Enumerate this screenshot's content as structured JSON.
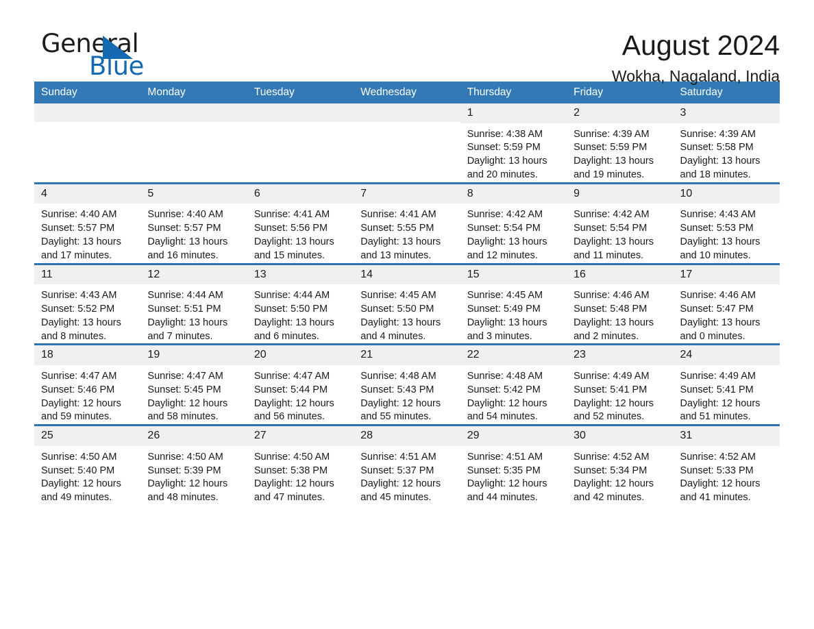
{
  "brand": {
    "name_part1": "General",
    "name_part2": "Blue",
    "triangle_color": "#1569b0",
    "blue_text_color": "#1569b0"
  },
  "header": {
    "title": "August 2024",
    "location": "Wokha, Nagaland, India"
  },
  "theme": {
    "header_blue": "#3279b6",
    "row_divider_blue": "#2e74b0",
    "daynum_band": "#f0f0f0",
    "text": "#1a1a1a"
  },
  "weekday_headers": [
    "Sunday",
    "Monday",
    "Tuesday",
    "Wednesday",
    "Thursday",
    "Friday",
    "Saturday"
  ],
  "weeks": [
    [
      {
        "day": "",
        "sunrise": "",
        "sunset": "",
        "daylight_line1": "",
        "daylight_line2": ""
      },
      {
        "day": "",
        "sunrise": "",
        "sunset": "",
        "daylight_line1": "",
        "daylight_line2": ""
      },
      {
        "day": "",
        "sunrise": "",
        "sunset": "",
        "daylight_line1": "",
        "daylight_line2": ""
      },
      {
        "day": "",
        "sunrise": "",
        "sunset": "",
        "daylight_line1": "",
        "daylight_line2": ""
      },
      {
        "day": "1",
        "sunrise": "Sunrise: 4:38 AM",
        "sunset": "Sunset: 5:59 PM",
        "daylight_line1": "Daylight: 13 hours",
        "daylight_line2": "and 20 minutes."
      },
      {
        "day": "2",
        "sunrise": "Sunrise: 4:39 AM",
        "sunset": "Sunset: 5:59 PM",
        "daylight_line1": "Daylight: 13 hours",
        "daylight_line2": "and 19 minutes."
      },
      {
        "day": "3",
        "sunrise": "Sunrise: 4:39 AM",
        "sunset": "Sunset: 5:58 PM",
        "daylight_line1": "Daylight: 13 hours",
        "daylight_line2": "and 18 minutes."
      }
    ],
    [
      {
        "day": "4",
        "sunrise": "Sunrise: 4:40 AM",
        "sunset": "Sunset: 5:57 PM",
        "daylight_line1": "Daylight: 13 hours",
        "daylight_line2": "and 17 minutes."
      },
      {
        "day": "5",
        "sunrise": "Sunrise: 4:40 AM",
        "sunset": "Sunset: 5:57 PM",
        "daylight_line1": "Daylight: 13 hours",
        "daylight_line2": "and 16 minutes."
      },
      {
        "day": "6",
        "sunrise": "Sunrise: 4:41 AM",
        "sunset": "Sunset: 5:56 PM",
        "daylight_line1": "Daylight: 13 hours",
        "daylight_line2": "and 15 minutes."
      },
      {
        "day": "7",
        "sunrise": "Sunrise: 4:41 AM",
        "sunset": "Sunset: 5:55 PM",
        "daylight_line1": "Daylight: 13 hours",
        "daylight_line2": "and 13 minutes."
      },
      {
        "day": "8",
        "sunrise": "Sunrise: 4:42 AM",
        "sunset": "Sunset: 5:54 PM",
        "daylight_line1": "Daylight: 13 hours",
        "daylight_line2": "and 12 minutes."
      },
      {
        "day": "9",
        "sunrise": "Sunrise: 4:42 AM",
        "sunset": "Sunset: 5:54 PM",
        "daylight_line1": "Daylight: 13 hours",
        "daylight_line2": "and 11 minutes."
      },
      {
        "day": "10",
        "sunrise": "Sunrise: 4:43 AM",
        "sunset": "Sunset: 5:53 PM",
        "daylight_line1": "Daylight: 13 hours",
        "daylight_line2": "and 10 minutes."
      }
    ],
    [
      {
        "day": "11",
        "sunrise": "Sunrise: 4:43 AM",
        "sunset": "Sunset: 5:52 PM",
        "daylight_line1": "Daylight: 13 hours",
        "daylight_line2": "and 8 minutes."
      },
      {
        "day": "12",
        "sunrise": "Sunrise: 4:44 AM",
        "sunset": "Sunset: 5:51 PM",
        "daylight_line1": "Daylight: 13 hours",
        "daylight_line2": "and 7 minutes."
      },
      {
        "day": "13",
        "sunrise": "Sunrise: 4:44 AM",
        "sunset": "Sunset: 5:50 PM",
        "daylight_line1": "Daylight: 13 hours",
        "daylight_line2": "and 6 minutes."
      },
      {
        "day": "14",
        "sunrise": "Sunrise: 4:45 AM",
        "sunset": "Sunset: 5:50 PM",
        "daylight_line1": "Daylight: 13 hours",
        "daylight_line2": "and 4 minutes."
      },
      {
        "day": "15",
        "sunrise": "Sunrise: 4:45 AM",
        "sunset": "Sunset: 5:49 PM",
        "daylight_line1": "Daylight: 13 hours",
        "daylight_line2": "and 3 minutes."
      },
      {
        "day": "16",
        "sunrise": "Sunrise: 4:46 AM",
        "sunset": "Sunset: 5:48 PM",
        "daylight_line1": "Daylight: 13 hours",
        "daylight_line2": "and 2 minutes."
      },
      {
        "day": "17",
        "sunrise": "Sunrise: 4:46 AM",
        "sunset": "Sunset: 5:47 PM",
        "daylight_line1": "Daylight: 13 hours",
        "daylight_line2": "and 0 minutes."
      }
    ],
    [
      {
        "day": "18",
        "sunrise": "Sunrise: 4:47 AM",
        "sunset": "Sunset: 5:46 PM",
        "daylight_line1": "Daylight: 12 hours",
        "daylight_line2": "and 59 minutes."
      },
      {
        "day": "19",
        "sunrise": "Sunrise: 4:47 AM",
        "sunset": "Sunset: 5:45 PM",
        "daylight_line1": "Daylight: 12 hours",
        "daylight_line2": "and 58 minutes."
      },
      {
        "day": "20",
        "sunrise": "Sunrise: 4:47 AM",
        "sunset": "Sunset: 5:44 PM",
        "daylight_line1": "Daylight: 12 hours",
        "daylight_line2": "and 56 minutes."
      },
      {
        "day": "21",
        "sunrise": "Sunrise: 4:48 AM",
        "sunset": "Sunset: 5:43 PM",
        "daylight_line1": "Daylight: 12 hours",
        "daylight_line2": "and 55 minutes."
      },
      {
        "day": "22",
        "sunrise": "Sunrise: 4:48 AM",
        "sunset": "Sunset: 5:42 PM",
        "daylight_line1": "Daylight: 12 hours",
        "daylight_line2": "and 54 minutes."
      },
      {
        "day": "23",
        "sunrise": "Sunrise: 4:49 AM",
        "sunset": "Sunset: 5:41 PM",
        "daylight_line1": "Daylight: 12 hours",
        "daylight_line2": "and 52 minutes."
      },
      {
        "day": "24",
        "sunrise": "Sunrise: 4:49 AM",
        "sunset": "Sunset: 5:41 PM",
        "daylight_line1": "Daylight: 12 hours",
        "daylight_line2": "and 51 minutes."
      }
    ],
    [
      {
        "day": "25",
        "sunrise": "Sunrise: 4:50 AM",
        "sunset": "Sunset: 5:40 PM",
        "daylight_line1": "Daylight: 12 hours",
        "daylight_line2": "and 49 minutes."
      },
      {
        "day": "26",
        "sunrise": "Sunrise: 4:50 AM",
        "sunset": "Sunset: 5:39 PM",
        "daylight_line1": "Daylight: 12 hours",
        "daylight_line2": "and 48 minutes."
      },
      {
        "day": "27",
        "sunrise": "Sunrise: 4:50 AM",
        "sunset": "Sunset: 5:38 PM",
        "daylight_line1": "Daylight: 12 hours",
        "daylight_line2": "and 47 minutes."
      },
      {
        "day": "28",
        "sunrise": "Sunrise: 4:51 AM",
        "sunset": "Sunset: 5:37 PM",
        "daylight_line1": "Daylight: 12 hours",
        "daylight_line2": "and 45 minutes."
      },
      {
        "day": "29",
        "sunrise": "Sunrise: 4:51 AM",
        "sunset": "Sunset: 5:35 PM",
        "daylight_line1": "Daylight: 12 hours",
        "daylight_line2": "and 44 minutes."
      },
      {
        "day": "30",
        "sunrise": "Sunrise: 4:52 AM",
        "sunset": "Sunset: 5:34 PM",
        "daylight_line1": "Daylight: 12 hours",
        "daylight_line2": "and 42 minutes."
      },
      {
        "day": "31",
        "sunrise": "Sunrise: 4:52 AM",
        "sunset": "Sunset: 5:33 PM",
        "daylight_line1": "Daylight: 12 hours",
        "daylight_line2": "and 41 minutes."
      }
    ]
  ]
}
